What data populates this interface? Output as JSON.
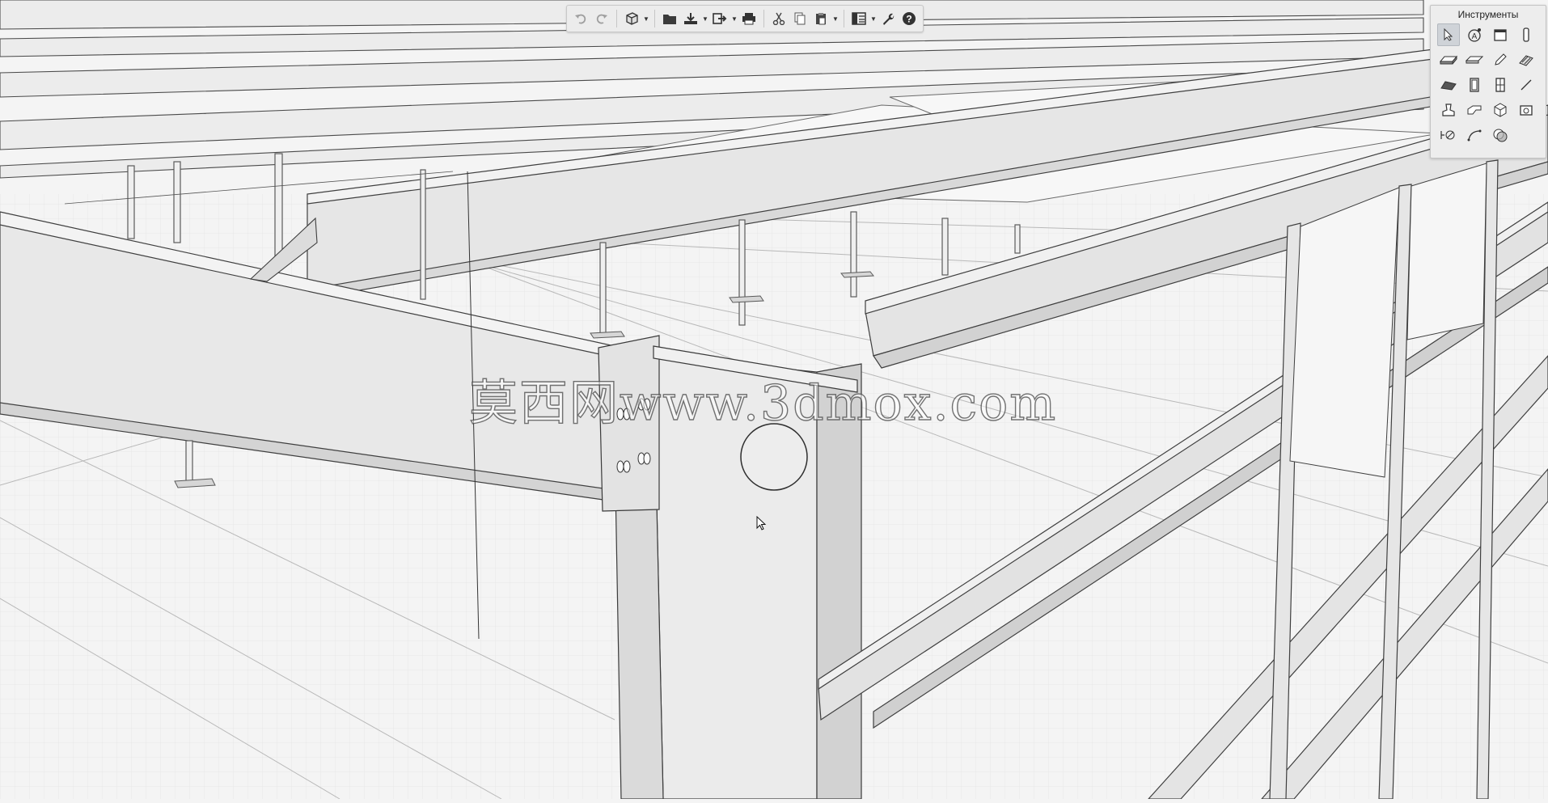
{
  "toolbar": {
    "buttons": [
      {
        "name": "undo-button",
        "icon": "undo-icon",
        "enabled": false
      },
      {
        "name": "redo-button",
        "icon": "redo-icon",
        "enabled": false
      },
      {
        "name": "view-cube-button",
        "icon": "cube-icon",
        "dropdown": true
      },
      {
        "name": "open-button",
        "icon": "folder-icon"
      },
      {
        "name": "import-button",
        "icon": "import-icon",
        "dropdown": true
      },
      {
        "name": "export-button",
        "icon": "export-icon",
        "dropdown": true
      },
      {
        "name": "print-button",
        "icon": "printer-icon"
      },
      {
        "name": "cut-button",
        "icon": "scissors-icon"
      },
      {
        "name": "copy-button",
        "icon": "copy-icon"
      },
      {
        "name": "paste-button",
        "icon": "clipboard-icon",
        "dropdown": true
      },
      {
        "name": "layout-button",
        "icon": "layout-icon",
        "dropdown": true
      },
      {
        "name": "settings-button",
        "icon": "wrench-icon"
      },
      {
        "name": "help-button",
        "icon": "question-icon"
      }
    ]
  },
  "tools_panel": {
    "title": "Инструменты",
    "tools": [
      {
        "name": "select-tool",
        "icon": "cursor-icon",
        "active": true
      },
      {
        "name": "dimension-tool",
        "icon": "circle-a-icon"
      },
      {
        "name": "panel-tool",
        "icon": "sheet-icon"
      },
      {
        "name": "column-tool",
        "icon": "column-icon"
      },
      {
        "name": "plate-tool",
        "icon": "plate-icon"
      },
      {
        "name": "slab-tool",
        "icon": "slab-icon"
      },
      {
        "name": "pencil-tool",
        "icon": "pencil-icon"
      },
      {
        "name": "rebar-tool",
        "icon": "rebar-icon"
      },
      {
        "name": "roof-tool",
        "icon": "roof-icon"
      },
      {
        "name": "door-tool",
        "icon": "door-icon"
      },
      {
        "name": "window-tool",
        "icon": "window-icon"
      },
      {
        "name": "line-tool",
        "icon": "line-icon"
      },
      {
        "name": "stamp-tool",
        "icon": "stamp-icon"
      },
      {
        "name": "profile-tool",
        "icon": "profile-icon"
      },
      {
        "name": "solid-tool",
        "icon": "polyhedron-icon"
      },
      {
        "name": "camera-tool",
        "icon": "camera-icon"
      },
      {
        "name": "measure-tool",
        "icon": "measure-icon"
      },
      {
        "name": "arc-tool",
        "icon": "arc-icon"
      },
      {
        "name": "boolean-tool",
        "icon": "boolean-icon"
      }
    ]
  },
  "watermark": "莫西网www.3dmox.com",
  "colors": {
    "background": "#f4f4f4",
    "steel": "#e9e9e9",
    "edge": "#4a4a4a",
    "grid": "#cfcfcf"
  }
}
